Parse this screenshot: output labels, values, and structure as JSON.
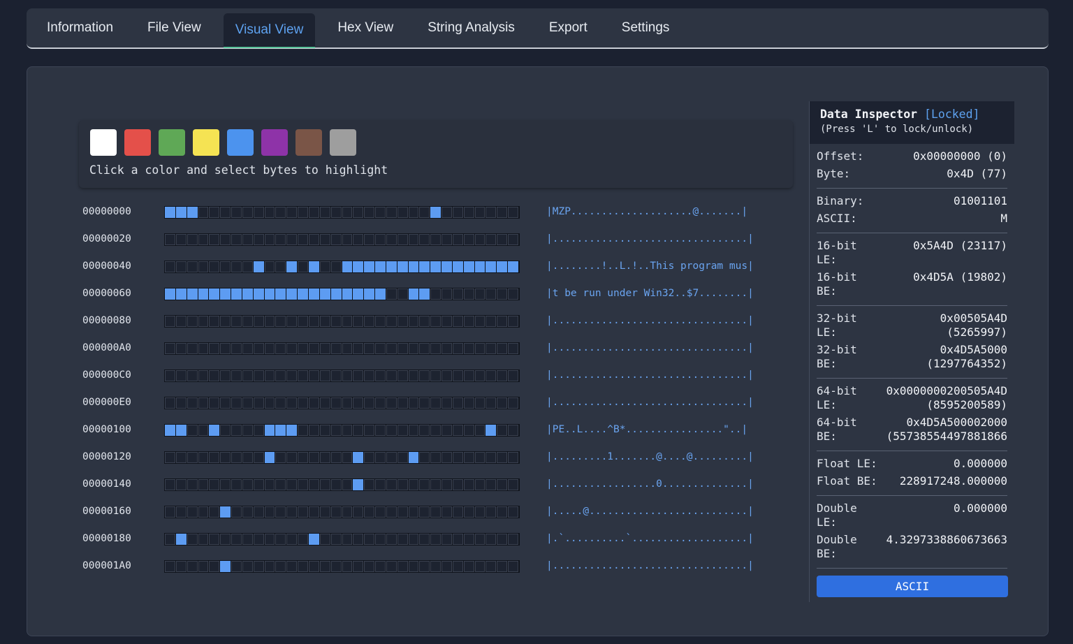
{
  "tabs": [
    {
      "label": "Information",
      "active": false
    },
    {
      "label": "File View",
      "active": false
    },
    {
      "label": "Visual View",
      "active": true
    },
    {
      "label": "Hex View",
      "active": false
    },
    {
      "label": "String Analysis",
      "active": false
    },
    {
      "label": "Export",
      "active": false
    },
    {
      "label": "Settings",
      "active": false
    }
  ],
  "palette": {
    "colors": [
      "#ffffff",
      "#e4504a",
      "#5fa856",
      "#f5e353",
      "#4c93ee",
      "#8e33a8",
      "#7a5547",
      "#9e9e9e"
    ],
    "hint": "Click a color and select bytes to highlight"
  },
  "highlight_color": "#5d9cf2",
  "rows": [
    {
      "offset": "00000000",
      "ascii": "|MZP....................@.......|",
      "highlight": [
        0,
        1,
        2,
        24
      ]
    },
    {
      "offset": "00000020",
      "ascii": "|................................|",
      "highlight": []
    },
    {
      "offset": "00000040",
      "ascii": "|........!..L.!..This program mus|",
      "highlight": [
        8,
        11,
        13,
        16,
        17,
        18,
        19,
        20,
        21,
        22,
        23,
        24,
        25,
        26,
        27,
        28,
        29,
        30,
        31
      ]
    },
    {
      "offset": "00000060",
      "ascii": "|t be run under Win32..$7........|",
      "highlight": [
        0,
        1,
        2,
        3,
        4,
        5,
        6,
        7,
        8,
        9,
        10,
        11,
        12,
        13,
        14,
        15,
        16,
        17,
        18,
        19,
        22,
        23
      ]
    },
    {
      "offset": "00000080",
      "ascii": "|................................|",
      "highlight": []
    },
    {
      "offset": "000000A0",
      "ascii": "|................................|",
      "highlight": []
    },
    {
      "offset": "000000C0",
      "ascii": "|................................|",
      "highlight": []
    },
    {
      "offset": "000000E0",
      "ascii": "|................................|",
      "highlight": []
    },
    {
      "offset": "00000100",
      "ascii": "|PE..L....^B*................\"..|",
      "highlight": [
        0,
        1,
        4,
        9,
        10,
        11,
        29
      ]
    },
    {
      "offset": "00000120",
      "ascii": "|.........1.......@....@.........|",
      "highlight": [
        9,
        17,
        22
      ]
    },
    {
      "offset": "00000140",
      "ascii": "|.................0..............|",
      "highlight": [
        17
      ]
    },
    {
      "offset": "00000160",
      "ascii": "|.....@..........................|",
      "highlight": [
        5
      ]
    },
    {
      "offset": "00000180",
      "ascii": "|.`..........`...................|",
      "highlight": [
        1,
        13
      ]
    },
    {
      "offset": "000001A0",
      "ascii": "|................................|",
      "highlight": [
        5
      ]
    }
  ],
  "inspector": {
    "title": "Data Inspector",
    "lock_status": "[Locked]",
    "hint": "(Press 'L' to lock/unlock)",
    "groups": [
      [
        {
          "k": "Offset:",
          "v": "0x00000000 (0)"
        },
        {
          "k": "Byte:",
          "v": "0x4D (77)"
        }
      ],
      [
        {
          "k": "Binary:",
          "v": "01001101"
        },
        {
          "k": "ASCII:",
          "v": "M"
        }
      ],
      [
        {
          "k": "16-bit LE:",
          "v": "0x5A4D (23117)"
        },
        {
          "k": "16-bit BE:",
          "v": "0x4D5A (19802)"
        }
      ],
      [
        {
          "k": "32-bit LE:",
          "v": "0x00505A4D\n(5265997)"
        },
        {
          "k": "32-bit BE:",
          "v": "0x4D5A5000\n(1297764352)"
        }
      ],
      [
        {
          "k": "64-bit LE:",
          "v": "0x0000000200505A4D\n(8595200589)"
        },
        {
          "k": "64-bit BE:",
          "v": "0x4D5A500002000\n(55738554497881866"
        }
      ],
      [
        {
          "k": "Float LE:",
          "v": "0.000000"
        },
        {
          "k": "Float BE:",
          "v": "228917248.000000"
        }
      ],
      [
        {
          "k": "Double LE:",
          "v": "0.000000"
        },
        {
          "k": "Double BE:",
          "v": "4.3297338860673663"
        }
      ]
    ],
    "button_label": "ASCII"
  }
}
